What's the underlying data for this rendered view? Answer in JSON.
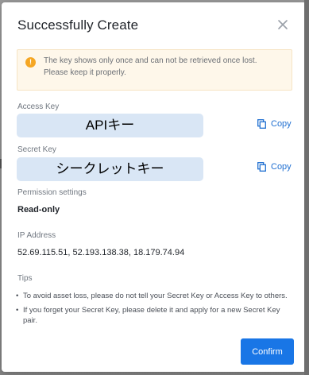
{
  "modal": {
    "title": "Successfully Create",
    "close_icon": "close-icon"
  },
  "notice": {
    "icon": "warning-icon",
    "text": "The key shows only once and can not be retrieved once lost. Please keep it properly."
  },
  "access_key": {
    "label": "Access Key",
    "value": "APIキー",
    "copy_label": "Copy"
  },
  "secret_key": {
    "label": "Secret Key",
    "value": "シークレットキー",
    "copy_label": "Copy"
  },
  "permission": {
    "label": "Permission settings",
    "value": "Read-only"
  },
  "ip": {
    "label": "IP Address",
    "value": "52.69.115.51, 52.193.138.38, 18.179.74.94"
  },
  "tips": {
    "label": "Tips",
    "items": [
      "To avoid asset loss, please do not tell your Secret Key or Access Key to others.",
      "If you forget your Secret Key, please delete it and apply for a new Secret Key pair."
    ]
  },
  "footer": {
    "confirm_label": "Confirm"
  },
  "colors": {
    "accent": "#1976e6",
    "key_highlight": "#d9e6f5",
    "notice_bg": "#fef7ea",
    "warning": "#f5a623"
  }
}
